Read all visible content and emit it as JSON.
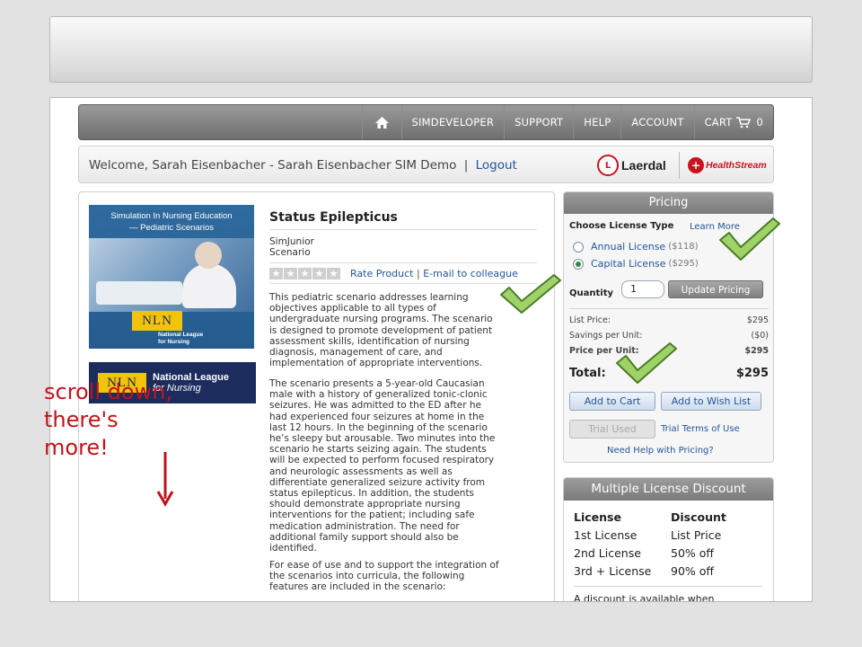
{
  "nav": {
    "home_icon": "home-icon",
    "items": [
      {
        "label": "SIMDEVELOPER"
      },
      {
        "label": "SUPPORT"
      },
      {
        "label": "HELP"
      },
      {
        "label": "ACCOUNT"
      }
    ],
    "cart": {
      "label": "CART",
      "icon": "cart-icon",
      "count": "0"
    }
  },
  "welcome": {
    "text": "Welcome, Sarah Eisenbacher - Sarah Eisenbacher SIM Demo",
    "separator": "|",
    "logout": "Logout",
    "brands": [
      "Laerdal",
      "HealthStream"
    ],
    "laerdal_badge": "L",
    "hs_badge": "+"
  },
  "product": {
    "cover": {
      "title_line1": "Simulation In Nursing Education",
      "title_line2": "— Pediatric Scenarios",
      "nln": "NLN",
      "caption_line1": "National League",
      "caption_line2": "for Nursing"
    },
    "nln_logo": {
      "abbr": "NLN",
      "line1": "National League",
      "line2": "for Nursing"
    },
    "title": "Status Epilepticus",
    "meta_line1": "SimJunior",
    "meta_line2": "Scenario",
    "rating": "0 of 5 stars",
    "rate_link": "Rate Product",
    "rate_sep": "|",
    "email_link": "E-mail to colleague",
    "desc_p1": [
      "This pediatric scenario addresses learning",
      "objectives applicable to all types of",
      "undergraduate nursing programs. The scenario",
      "is designed to promote development of patient",
      "assessment skills, identification of nursing",
      "diagnosis, management of care, and",
      "implementation of appropriate interventions."
    ],
    "desc_p2": [
      "The scenario presents a 5-year-old Caucasian",
      "male with a history of generalized tonic-clonic",
      "seizures. He was admitted to the ED after he",
      "had experienced four seizures at home in the",
      "last 12 hours. In the beginning of the scenario",
      "he’s sleepy but arousable. Two minutes into the",
      "scenario he starts seizing again. The students",
      "will be expected to perform focused respiratory",
      "and neurologic assessments as well as",
      "differentiate generalized seizure activity from",
      "status epilepticus. In addition, the students",
      "should demonstrate appropriate nursing",
      "interventions for the patient; including safe",
      "medication administration. The need for",
      "additional family support should also be",
      "identified."
    ],
    "desc_p3": [
      "For ease of use and to support the integration of",
      "the scenarios into curricula, the following",
      "features are included in the scenario:"
    ]
  },
  "annotation": {
    "lines": [
      "scroll down,",
      "there's",
      "more!"
    ],
    "color": "#c0141b"
  },
  "pricing": {
    "header": "Pricing",
    "choose_label": "Choose License Type",
    "learn_more": "Learn More",
    "options": [
      {
        "label": "Annual License",
        "price": "($118)",
        "selected": false
      },
      {
        "label": "Capital License",
        "price": "($295)",
        "selected": true
      }
    ],
    "quantity_label": "Quantity",
    "quantity_value": "1",
    "update_button": "Update Pricing",
    "list_price_label": "List Price:",
    "list_price": "$295",
    "savings_label": "Savings per Unit:",
    "savings": "($0)",
    "price_per_unit_label": "Price per Unit:",
    "price_per_unit": "$295",
    "total_label": "Total:",
    "total": "$295",
    "add_to_cart": "Add to Cart",
    "add_to_wish": "Add to Wish List",
    "trial_used": "Trial Used",
    "trial_terms": "Trial Terms of Use",
    "need_help": "Need Help with Pricing?"
  },
  "discount": {
    "header": "Multiple License Discount",
    "col1": "License",
    "col2": "Discount",
    "rows": [
      {
        "license": "1st License",
        "discount": "List Price"
      },
      {
        "license": "2nd License",
        "discount": "50% off"
      },
      {
        "license": "3rd + License",
        "discount": "90% off"
      }
    ],
    "note": "A discount is available when"
  },
  "colors": {
    "link": "#22559c",
    "check_green": "#76b043",
    "brand_red": "#c8141e",
    "nln_gold": "#f3c30b",
    "nln_navy": "#1b2c5d"
  }
}
